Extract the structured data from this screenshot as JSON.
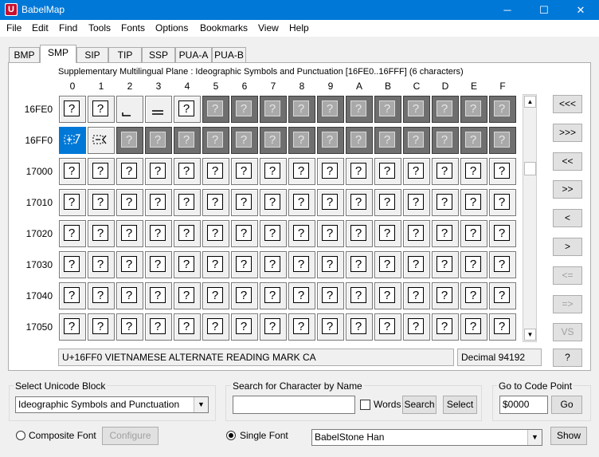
{
  "window": {
    "title": "BabelMap",
    "app_icon_letter": "U",
    "controls": [
      "─",
      "☐",
      "✕"
    ]
  },
  "menu": [
    "File",
    "Edit",
    "Find",
    "Tools",
    "Fonts",
    "Options",
    "Bookmarks",
    "View",
    "Help"
  ],
  "tabs": [
    "BMP",
    "SMP",
    "SIP",
    "TIP",
    "SSP",
    "PUA-A",
    "PUA-B"
  ],
  "active_tab": "SMP",
  "grid": {
    "block_title": "Supplementary Multilingual Plane : Ideographic Symbols and Punctuation [16FE0..16FFF] (6 characters)",
    "col_headers": [
      "0",
      "1",
      "2",
      "3",
      "4",
      "5",
      "6",
      "7",
      "8",
      "9",
      "A",
      "B",
      "C",
      "D",
      "E",
      "F"
    ],
    "row_headers": [
      "16FE0",
      "16FF0",
      "17000",
      "17010",
      "17020",
      "17030",
      "17040",
      "17050"
    ],
    "missing_glyph": "?",
    "selected_code": "16FF0"
  },
  "nav_buttons": [
    "<<<",
    ">>>",
    "<<",
    ">>",
    "<",
    ">",
    "<=",
    "=>",
    "VS",
    "?"
  ],
  "status": {
    "character": "U+16FF0 VIETNAMESE ALTERNATE READING MARK CA",
    "decimal": "Decimal 94192"
  },
  "select_block": {
    "label": "Select Unicode Block",
    "value": "Ideographic Symbols and Punctuation"
  },
  "search": {
    "label": "Search for Character by Name",
    "value": "",
    "words_label": "Words",
    "words_checked": false,
    "search_button": "Search",
    "select_button": "Select"
  },
  "goto": {
    "label": "Go to Code Point",
    "value": "$0000",
    "button": "Go"
  },
  "font": {
    "composite_label": "Composite Font",
    "configure_button": "Configure",
    "single_label": "Single Font",
    "single_selected": true,
    "font_value": "BabelStone Han",
    "show_button": "Show"
  },
  "colors": {
    "titlebar": "#0078d7",
    "selection": "#0078d7",
    "unassigned_cell": "#6f6f6f"
  }
}
